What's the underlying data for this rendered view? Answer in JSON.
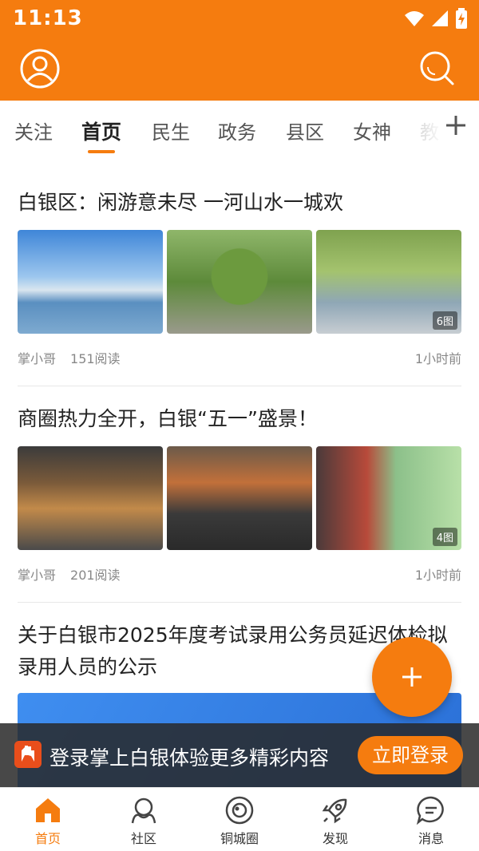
{
  "status_bar": {
    "time": "11:13"
  },
  "colors": {
    "accent": "#f57c0f",
    "accent_dark": "#e06a00"
  },
  "top_bar": {
    "left_icon": "user-avatar-icon",
    "right_icon": "search-icon"
  },
  "tabs": {
    "items": [
      {
        "label": "关注"
      },
      {
        "label": "首页"
      },
      {
        "label": "民生"
      },
      {
        "label": "政务"
      },
      {
        "label": "县区"
      },
      {
        "label": "女神"
      },
      {
        "label": "教"
      }
    ],
    "active_index": 1,
    "add_icon": "plus-icon"
  },
  "articles": [
    {
      "title": "白银区：闲游意未尽  一河山水一城欢",
      "author": "掌小哥",
      "reads": "151阅读",
      "time": "1小时前",
      "image_count": "6图"
    },
    {
      "title": "商圈热力全开，白银“五一”盛景！",
      "author": "掌小哥",
      "reads": "201阅读",
      "time": "1小时前",
      "image_count": "4图"
    },
    {
      "title": "关于白银市2025年度考试录用公务员延迟体检拟录用人员的公示"
    }
  ],
  "fab": {
    "icon": "plus-icon"
  },
  "login_prompt": {
    "text": "登录掌上白银体验更多精彩内容",
    "button": "立即登录"
  },
  "bottom_nav": [
    {
      "label": "首页",
      "icon": "home-icon"
    },
    {
      "label": "社区",
      "icon": "community-icon"
    },
    {
      "label": "铜城圈",
      "icon": "circle-icon"
    },
    {
      "label": "发现",
      "icon": "rocket-icon"
    },
    {
      "label": "消息",
      "icon": "message-icon"
    }
  ]
}
